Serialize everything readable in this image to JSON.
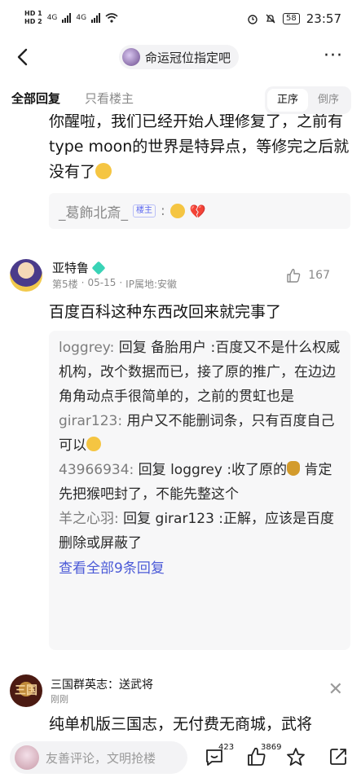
{
  "status_bar": {
    "sim1": "HD 1",
    "sim2": "HD 2",
    "network1": "4G",
    "network2": "4G",
    "battery": "58",
    "time": "23:57"
  },
  "nav": {
    "title": "命运冠位指定吧",
    "more": "···"
  },
  "tabs": {
    "all_replies": "全部回复",
    "only_op": "只看楼主",
    "sort_asc": "正序",
    "sort_desc": "倒序"
  },
  "previous_post": {
    "text": "你醒啦，我们已经开始人理修复了，之前有type moon的世界是特异点，等修完之后就没有了",
    "sub_reply_user": "_葛飾北斎_",
    "sub_reply_badge": "楼主",
    "sub_reply_sep": ":"
  },
  "post5": {
    "username": "亚特鲁",
    "floor": "第5楼",
    "date": "05-15",
    "ip": "IP属地:安徽",
    "likes": "167",
    "content": "百度百科这种东西改回来就完事了",
    "replies": [
      {
        "user": "loggrey:",
        "text": "回复 备胎用户 :百度又不是什么权威机构，改个数据而已，接了原的推广，在边边角角动点手很简单的，之前的贯虹也是"
      },
      {
        "user": "girar123:",
        "text": "用户又不能删词条，只有百度自己可以"
      },
      {
        "user": "43966934:",
        "text": "回复 loggrey :收了原的",
        "text2": "肯定先把猴吧封了，不能先整这个"
      },
      {
        "user": "羊之心羽:",
        "text": "回复 girar123 :正解，应该是百度删除或屏蔽了"
      }
    ],
    "view_all": "查看全部9条回复"
  },
  "next_post": {
    "avatar_text": "三国",
    "username": "三国群英志：送武将",
    "time": "刚刚",
    "content": "纯单机版三国志，无付费无商城，武将"
  },
  "bottom_bar": {
    "placeholder": "友善评论，文明抢楼",
    "comment_count": "423",
    "like_count": "3869"
  }
}
